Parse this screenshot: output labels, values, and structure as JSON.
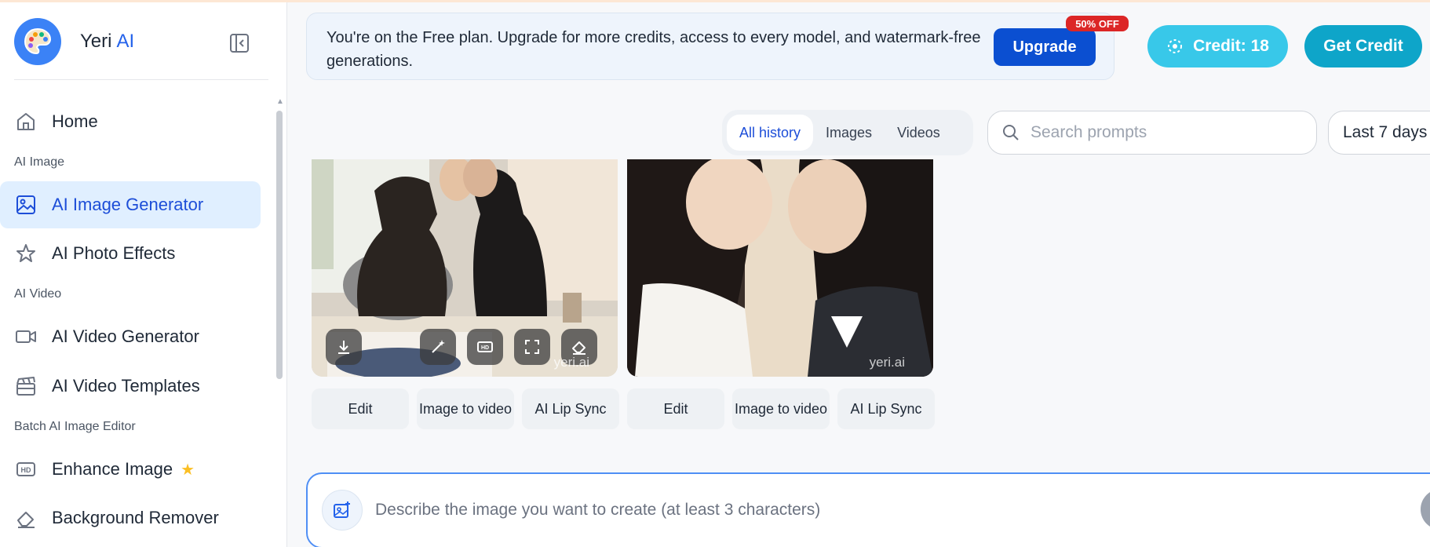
{
  "brand": {
    "name": "Yeri",
    "accent": "AI",
    "accent_color": "#2563eb"
  },
  "sidebar": {
    "items": [
      {
        "label": "Home",
        "icon": "home-icon"
      },
      {
        "section": "AI Image"
      },
      {
        "label": "AI Image Generator",
        "icon": "image-icon",
        "active": true
      },
      {
        "label": "AI Photo Effects",
        "icon": "star-icon"
      },
      {
        "section": "AI Video"
      },
      {
        "label": "AI Video Generator",
        "icon": "video-camera-icon"
      },
      {
        "label": "AI Video Templates",
        "icon": "clapperboard-icon"
      },
      {
        "section": "Batch AI Image Editor"
      },
      {
        "label": "Enhance Image",
        "icon": "hd-icon",
        "badge_icon": "star-icon"
      },
      {
        "label": "Background Remover",
        "icon": "eraser-icon"
      }
    ]
  },
  "banner": {
    "text": "You're on the Free plan. Upgrade for more credits, access to every model, and watermark-free generations.",
    "upgrade_label": "Upgrade",
    "discount_badge": "50% OFF"
  },
  "header": {
    "credit_label": "Credit: 18",
    "get_credit_label": "Get Credit"
  },
  "filters": {
    "tabs": [
      "All history",
      "Images",
      "Videos"
    ],
    "active_tab": "All history",
    "search_placeholder": "Search prompts",
    "date_range": "Last 7 days"
  },
  "gallery": {
    "cards": [
      {
        "watermark": "yeri.ai",
        "actions": [
          "Edit",
          "Image to video",
          "AI Lip Sync"
        ],
        "hover_tools": [
          "download-icon",
          "magic-wand-icon",
          "hd-icon",
          "expand-icon",
          "eraser-icon"
        ]
      },
      {
        "watermark": "yeri.ai",
        "actions": [
          "Edit",
          "Image to video",
          "AI Lip Sync"
        ]
      }
    ]
  },
  "prompt": {
    "placeholder": "Describe the image you want to create (at least 3 characters)"
  },
  "colors": {
    "primary": "#0b4fd1",
    "credit": "#38c8e9",
    "get_credit": "#0ea5c9",
    "active_nav_bg": "#e0efff"
  }
}
